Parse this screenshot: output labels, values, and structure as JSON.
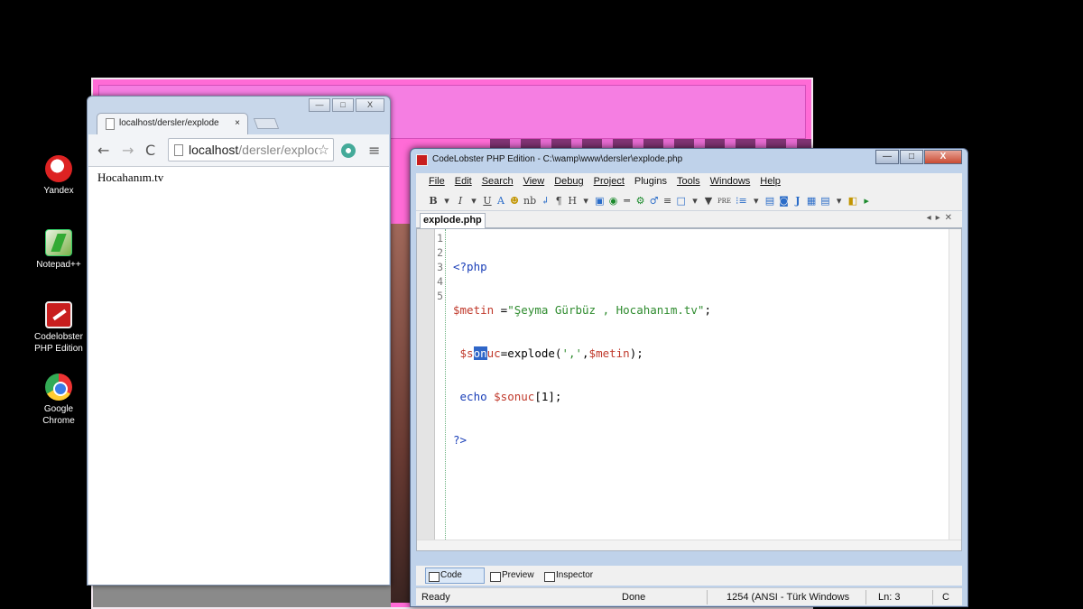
{
  "desktop": {
    "icons": [
      {
        "label": "Yandex"
      },
      {
        "label": "Notepad++"
      },
      {
        "label_line1": "Codelobster",
        "label_line2": "PHP Edition"
      },
      {
        "label_line1": "Google",
        "label_line2": "Chrome"
      }
    ]
  },
  "browser": {
    "tab_title": "localhost/dersler/explode",
    "tab_close": "×",
    "address_host": "localhost",
    "address_path": "/dersler/exploc",
    "page_text": "Hocahanım.tv",
    "controls": {
      "minimize": "—",
      "maximize": "□",
      "close": "X"
    }
  },
  "codelobster": {
    "title": "CodeLobster PHP Edition - C:\\wamp\\www\\dersler\\explode.php",
    "menu": [
      "File",
      "Edit",
      "Search",
      "View",
      "Debug",
      "Project",
      "Plugins",
      "Tools",
      "Windows",
      "Help"
    ],
    "toolbar_glyphs": [
      "B",
      "▾",
      "I",
      "▾",
      "U",
      "A",
      "☻",
      "nb",
      "↲",
      "¶",
      "H",
      "▾",
      "▣",
      "◉",
      "═",
      "⚙",
      "♂",
      "≡",
      "□",
      "▾",
      "▼",
      "PRE",
      "⁝≡",
      "▾",
      "▤",
      "◙",
      "J",
      "▦",
      "▤",
      "▾",
      "◧",
      "▸"
    ],
    "file_tab": "explode.php",
    "line_numbers": [
      "1",
      "2",
      "3",
      "4",
      "5"
    ],
    "code": {
      "l1": "<?php",
      "l2_var": "$metin",
      "l2_op": " =",
      "l2_str": "\"Şeyma Gürbüz , Hocahanım.tv\"",
      "l2_end": ";",
      "l3_a": " $s",
      "l3_sel": "on",
      "l3_b": "uc",
      "l3_op": "=explode(",
      "l3_str": "','",
      "l3_c": ",",
      "l3_var": "$metin",
      "l3_end": ");",
      "l4_kw": " echo ",
      "l4_var": "$sonuc",
      "l4_end": "[1];",
      "l5": "?>"
    },
    "bottom_tabs": [
      "Code",
      "Preview",
      "Inspector"
    ],
    "status": {
      "ready": "Ready",
      "done": "Done",
      "encoding": "1254 (ANSI - Türk Windows",
      "line": "Ln: 3",
      "col": "C"
    },
    "window_controls": {
      "minimize": "—",
      "maximize": "□",
      "close": "X"
    }
  }
}
